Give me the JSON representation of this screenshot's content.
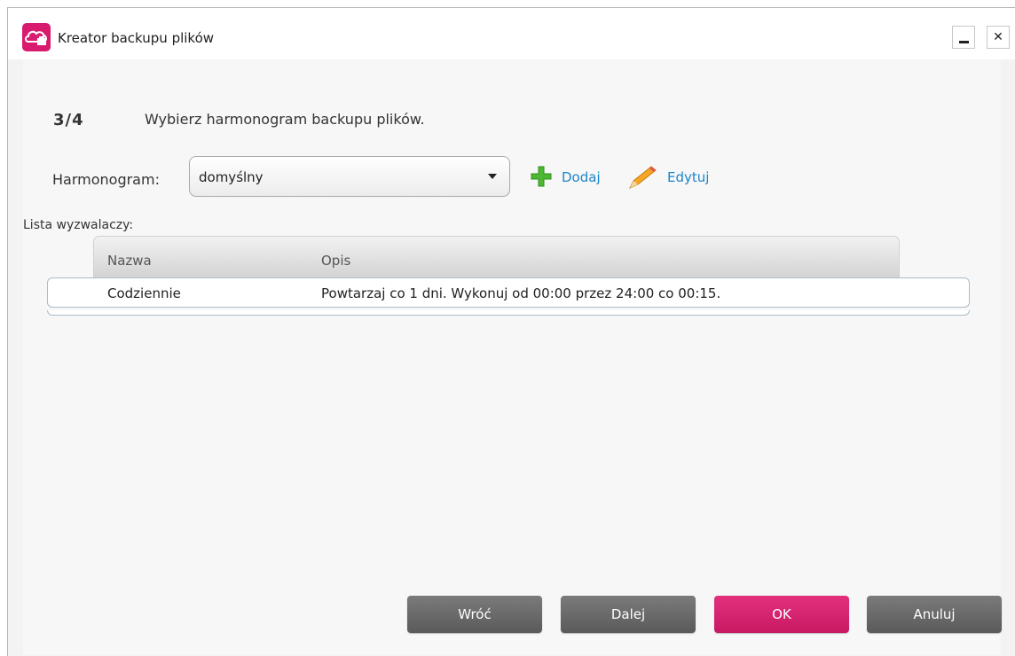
{
  "window": {
    "title": "Kreator backupu plików",
    "minimize_label": "",
    "close_label": "✕"
  },
  "step": {
    "number": "3/4",
    "text": "Wybierz harmonogram backupu plików."
  },
  "schedule": {
    "label": "Harmonogram:",
    "selected": "domyślny",
    "add_label": "Dodaj",
    "edit_label": "Edytuj"
  },
  "triggers": {
    "label": "Lista wyzwalaczy:",
    "columns": [
      "Nazwa",
      "Opis"
    ],
    "rows": [
      {
        "name": "Codziennie",
        "description": "Powtarzaj co 1 dni. Wykonuj od 00:00 przez 24:00 co 00:15."
      }
    ]
  },
  "buttons": {
    "back": "Wróć",
    "next": "Dalej",
    "ok": "OK",
    "cancel": "Anuluj"
  },
  "colors": {
    "accent": "#d81b6f",
    "link": "#1a84c9",
    "button_gray": "#6a6a6a"
  },
  "icons": {
    "app": "cloud-backup-icon",
    "add": "green-plus-icon",
    "edit": "pencil-icon"
  }
}
